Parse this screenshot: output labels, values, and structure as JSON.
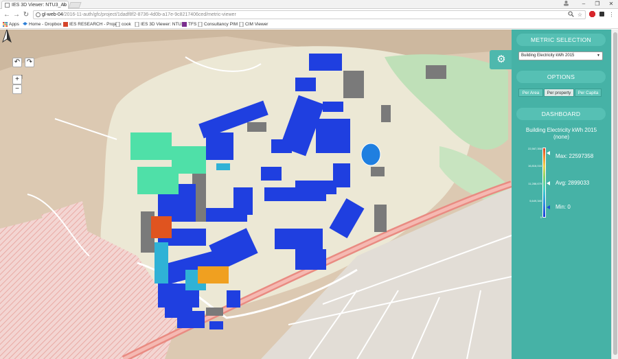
{
  "browser": {
    "tab_title": "IES 3D Viewer: NTU3_Ab",
    "close_glyph": "×",
    "url_host": "gl-web-04",
    "url_path": "/2016-11-auth/gfc/project/1dadf8f2-8736-4d0b-a17e-9c8217406ced/metric-viewer",
    "bookmarks": [
      {
        "label": "Apps",
        "icon": "apps-grid-icon",
        "color": "#d44"
      },
      {
        "label": "Home - Dropbox",
        "icon": "dropbox-icon",
        "color": "#2d7fd6"
      },
      {
        "label": "IES RESEARCH - Proje",
        "icon": "ies-icon",
        "color": "#d4442a"
      },
      {
        "label": "cook",
        "icon": "page-icon",
        "color": "#888"
      },
      {
        "label": "IES 3D Viewer: NTU2",
        "icon": "page-icon",
        "color": "#888"
      },
      {
        "label": "TFS",
        "icon": "tfs-icon",
        "color": "#7a2e8e"
      },
      {
        "label": "Consultancy PIM",
        "icon": "page-icon",
        "color": "#888"
      },
      {
        "label": "CIM Viewer",
        "icon": "page-icon",
        "color": "#888"
      }
    ]
  },
  "map": {
    "north_label": "N",
    "undo_glyph": "↶",
    "redo_glyph": "↷",
    "zoom_in": "+",
    "zoom_out": "−",
    "settings_glyph": "⚙"
  },
  "panel": {
    "metric_header": "METRIC SELECTION",
    "metric_selected": "Building Electricity kWh 2015",
    "options_header": "OPTIONS",
    "options": [
      {
        "label": "Per Area",
        "active": false
      },
      {
        "label": "Per property",
        "active": true
      },
      {
        "label": "Per Capita",
        "active": false
      }
    ],
    "dashboard_header": "DASHBOARD",
    "dashboard_title": "Building Electricity kWh 2015",
    "dashboard_subtitle": "(none)",
    "legend_ticks": [
      "22,567,358",
      "16,816,016",
      "11,288,679",
      "5,649,340",
      "0"
    ],
    "max_label": "Max: 22597358",
    "avg_label": "Avg: 2899033",
    "min_label": "Min: 0"
  },
  "colors": {
    "panel": "#46b2a6",
    "panel_header": "#56c0b4",
    "building_low": "#1a3bd6",
    "building_high": "#e0541f"
  }
}
